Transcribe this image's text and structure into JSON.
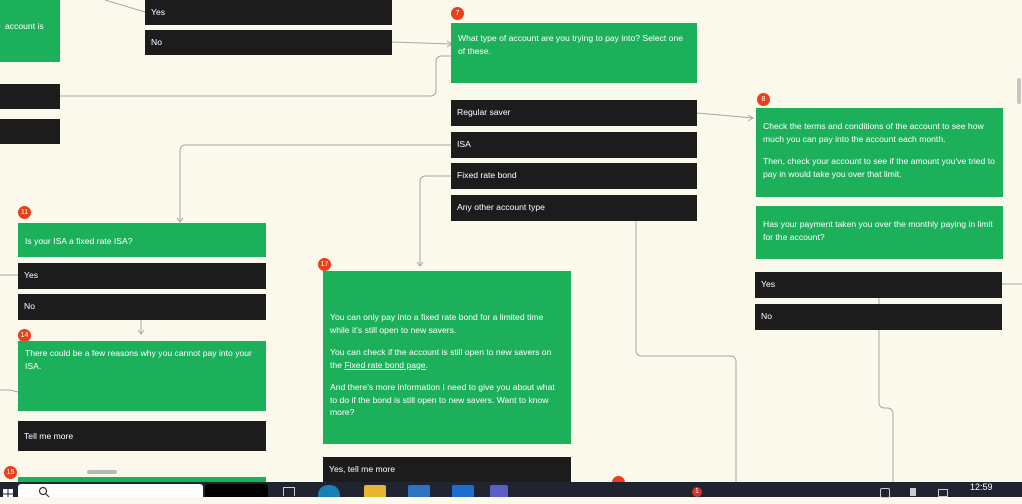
{
  "palette": {
    "background": "#fbf9ec",
    "question": "#1db05b",
    "option": "#1c1c1c",
    "badge": "#e8401c",
    "connector": "#a6a6a6"
  },
  "nodes": {
    "top_left_text": "account is",
    "yes_top": "Yes",
    "no_top": "No",
    "q7": {
      "number": "7",
      "text": "What type of account are you trying to pay into? Select one of these.",
      "options": [
        "Regular saver",
        "ISA",
        "Fixed rate bond",
        "Any other account type"
      ]
    },
    "q8": {
      "number": "8",
      "para1": "Check the terms and conditions of the account to see how much you can pay into the account each month.",
      "para2": "Then, check your account to see if the amount you've tried to pay in would take you over that limit."
    },
    "q8b": {
      "text": "Has your payment taken you over the monthly paying in limit for the account?",
      "options": [
        "Yes",
        "No"
      ]
    },
    "q11": {
      "number": "11",
      "text": "Is your ISA a fixed rate ISA?",
      "options": [
        "Yes",
        "No"
      ]
    },
    "q14": {
      "number": "14",
      "text": "There could be a few reasons why you cannot pay into your ISA.",
      "options": [
        "Tell me more"
      ]
    },
    "q15": {
      "number": "15"
    },
    "q17": {
      "number": "17",
      "para1": "You can only pay into a fixed rate bond for a limited time while it's still open to new savers.",
      "para2_a": "You can check if the account is still open to new savers on the",
      "para2_link": "Fixed rate bond page",
      "para2_b": ".",
      "para3": "And there's more information I need to give you about what to do if the bond is still open to new savers. Want to know more?",
      "options": [
        "Yes, tell me more"
      ]
    }
  },
  "taskbar": {
    "time": "12:59",
    "notification_count": "1",
    "apps": [
      "search-box",
      "task-view-icon",
      "edge-browser-icon",
      "file-explorer-icon",
      "store-icon",
      "mail-icon",
      "teams-icon"
    ]
  }
}
